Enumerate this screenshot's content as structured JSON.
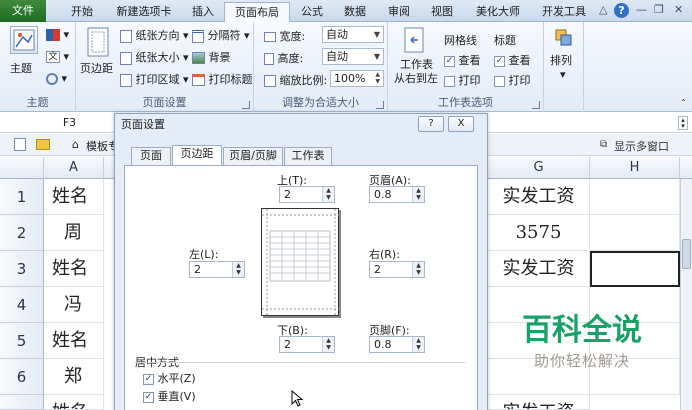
{
  "tabs": [
    "文件",
    "开始",
    "新建选项卡",
    "插入",
    "页面布局",
    "公式",
    "数据",
    "审阅",
    "视图",
    "美化大师",
    "开发工具"
  ],
  "active_tab": "页面布局",
  "ribbon": {
    "theme_group": {
      "label": "主题",
      "theme_btn": "主题"
    },
    "page_setup_group": {
      "label": "页面设置",
      "margins": "页边距",
      "orientation": "纸张方向",
      "size": "纸张大小",
      "print_area": "打印区域",
      "breaks": "分隔符",
      "background": "背景",
      "print_titles": "打印标题"
    },
    "scale_group": {
      "label": "调整为合适大小",
      "width_label": "宽度:",
      "width_value": "自动",
      "height_label": "高度:",
      "height_value": "自动",
      "scale_label": "缩放比例:",
      "scale_value": "100%"
    },
    "sheet_options_group": {
      "label": "工作表选项",
      "rtl_line1": "工作表",
      "rtl_line2": "从右到左",
      "gridlines": "网格线",
      "headings": "标题",
      "view": "查看",
      "print": "打印"
    },
    "arrange_group": {
      "arrange": "排列"
    }
  },
  "name_box": "F3",
  "toolbar": {
    "template_label": "模板专",
    "multi_window": "显示多窗口"
  },
  "grid": {
    "columns": [
      "A",
      "G",
      "H"
    ],
    "rows": [
      {
        "num": "1",
        "a": "姓名",
        "g": "实发工资"
      },
      {
        "num": "2",
        "a": "周",
        "g": "3575"
      },
      {
        "num": "3",
        "a": "姓名",
        "g": "实发工资"
      },
      {
        "num": "4",
        "a": "冯",
        "g": ""
      },
      {
        "num": "5",
        "a": "姓名",
        "g": ""
      },
      {
        "num": "6",
        "a": "郑",
        "g": ""
      },
      {
        "num": "",
        "a": "姓名",
        "g": "实发工资"
      }
    ]
  },
  "dialog": {
    "title": "页面设置",
    "help_btn": "?",
    "close_btn": "X",
    "tabs": [
      "页面",
      "页边距",
      "页眉/页脚",
      "工作表"
    ],
    "active_tab": "页边距",
    "top_label": "上(T):",
    "top_value": "2",
    "header_label": "页眉(A):",
    "header_value": "0.8",
    "left_label": "左(L):",
    "left_value": "2",
    "right_label": "右(R):",
    "right_value": "2",
    "bottom_label": "下(B):",
    "bottom_value": "2",
    "footer_label": "页脚(F):",
    "footer_value": "0.8",
    "center_section": "居中方式",
    "horizontal": "水平(Z)",
    "vertical": "垂直(V)",
    "horizontal_checked": true,
    "vertical_checked": true
  },
  "watermark": {
    "line1": "百科全说",
    "line2": "助你轻松解决"
  }
}
